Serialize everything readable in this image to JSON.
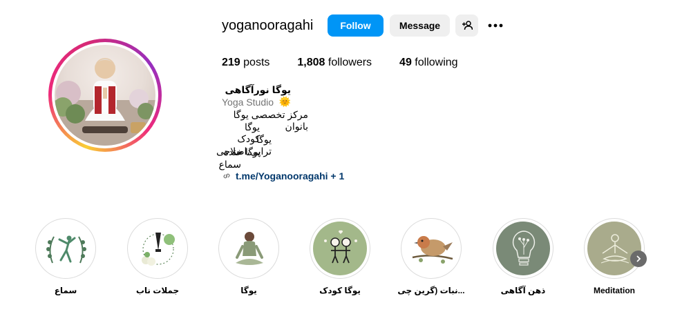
{
  "profile": {
    "username": "yoganooragahi",
    "follow_label": "Follow",
    "message_label": "Message",
    "posts_count": "219",
    "posts_label": "posts",
    "followers_count": "1,808",
    "followers_label": "followers",
    "following_count": "49",
    "following_label": "following"
  },
  "bio": {
    "name": "یوگا نورآگاهی🌞",
    "category": "Yoga Studio",
    "lines": [
      "مرکز تخصصی یوگا بانوان",
      "یوگا کودک",
      "یوگا تراپی،اصلاحی",
      "یوگا خنده",
      "سماع"
    ],
    "link": "t.me/Yoganooragahi + 1"
  },
  "highlights": [
    {
      "label": "سماع",
      "icon": "dancer-icon"
    },
    {
      "label": "جملات ناب",
      "icon": "quill-pen-icon"
    },
    {
      "label": "یوگا",
      "icon": "meditation-woman-icon"
    },
    {
      "label": "یوگا کودک",
      "icon": "kids-icon"
    },
    {
      "label": "نبات (گرین چی...",
      "icon": "bird-icon"
    },
    {
      "label": "ذهن آگاهی",
      "icon": "lightbulb-icon"
    },
    {
      "label": "Meditation",
      "icon": "meditation-icon"
    }
  ],
  "colors": {
    "follow_blue": "#0095f6",
    "link_blue": "#00376b",
    "button_gray": "#efefef"
  }
}
